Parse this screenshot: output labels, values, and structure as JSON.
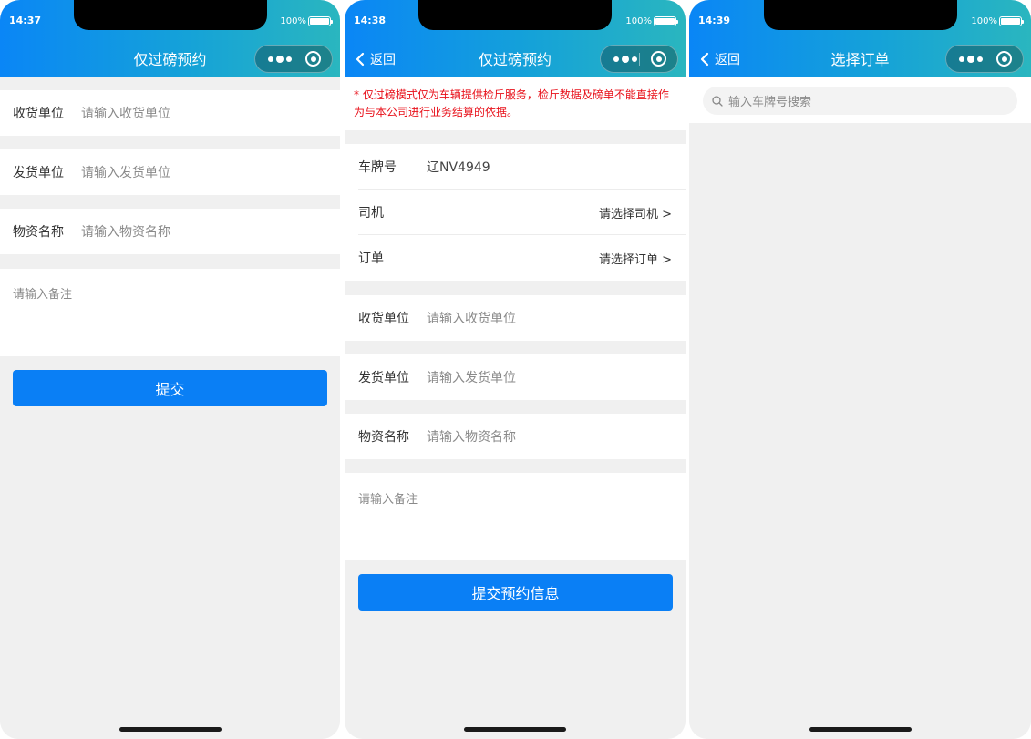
{
  "status_bar": {
    "battery": "100%",
    "times": [
      "14:37",
      "14:38",
      "14:39"
    ]
  },
  "screen1": {
    "title": "仅过磅预约",
    "fields": [
      {
        "label": "收货单位",
        "placeholder": "请输入收货单位"
      },
      {
        "label": "发货单位",
        "placeholder": "请输入发货单位"
      },
      {
        "label": "物资名称",
        "placeholder": "请输入物资名称"
      }
    ],
    "remark_placeholder": "请输入备注",
    "submit_label": "提交"
  },
  "screen2": {
    "title": "仅过磅预约",
    "back_label": "返回",
    "notice": "* 仅过磅模式仅为车辆提供检斤服务，检斤数据及磅单不能直接作为与本公司进行业务结算的依据。",
    "plate": {
      "label": "车牌号",
      "value": "辽NV4949"
    },
    "driver": {
      "label": "司机",
      "action": "请选择司机 >"
    },
    "order": {
      "label": "订单",
      "action": "请选择订单 >"
    },
    "fields": [
      {
        "label": "收货单位",
        "placeholder": "请输入收货单位"
      },
      {
        "label": "发货单位",
        "placeholder": "请输入发货单位"
      },
      {
        "label": "物资名称",
        "placeholder": "请输入物资名称"
      }
    ],
    "remark_placeholder": "请输入备注",
    "submit_label": "提交预约信息"
  },
  "screen3": {
    "title": "选择订单",
    "back_label": "返回",
    "search_placeholder": "输入车牌号搜索"
  },
  "icons": [
    "chevron-left-icon",
    "more-dots-icon",
    "target-icon",
    "search-icon",
    "battery-icon"
  ]
}
